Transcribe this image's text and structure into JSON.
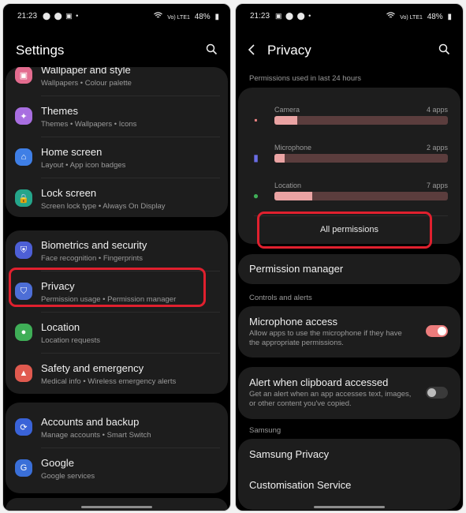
{
  "left": {
    "status": {
      "time": "21:23",
      "icons": "⬤ ⬤ ▣ •",
      "signal": "Vo) LTE1",
      "battery": "48%"
    },
    "title": "Settings",
    "card1": [
      {
        "title": "Wallpaper and style",
        "subtitle": "Wallpapers  •  Colour palette",
        "icon": "wallpaper-icon",
        "color": "#e36c8f"
      },
      {
        "title": "Themes",
        "subtitle": "Themes  •  Wallpapers  •  Icons",
        "icon": "themes-icon",
        "color": "#a86ee0"
      },
      {
        "title": "Home screen",
        "subtitle": "Layout  •  App icon badges",
        "icon": "home-icon",
        "color": "#3f7fe6"
      },
      {
        "title": "Lock screen",
        "subtitle": "Screen lock type  •  Always On Display",
        "icon": "lock-icon",
        "color": "#25a58a"
      }
    ],
    "card2": [
      {
        "title": "Biometrics and security",
        "subtitle": "Face recognition  •  Fingerprints",
        "icon": "shield-icon",
        "color": "#4d5fd6"
      },
      {
        "title": "Privacy",
        "subtitle": "Permission usage  •  Permission manager",
        "icon": "privacy-icon",
        "color": "#4d6ed6"
      },
      {
        "title": "Location",
        "subtitle": "Location requests",
        "icon": "location-pin-icon",
        "color": "#3fae57"
      },
      {
        "title": "Safety and emergency",
        "subtitle": "Medical info  •  Wireless emergency alerts",
        "icon": "emergency-icon",
        "color": "#e05a4f"
      }
    ],
    "card3": [
      {
        "title": "Accounts and backup",
        "subtitle": "Manage accounts  •  Smart Switch",
        "icon": "sync-icon",
        "color": "#3a63d8"
      },
      {
        "title": "Google",
        "subtitle": "Google services",
        "icon": "google-icon",
        "color": "#3a6fd8"
      }
    ]
  },
  "right": {
    "status": {
      "time": "21:23",
      "icons": "▣ ⬤ ⬤ •",
      "signal": "Vo) LTE1",
      "battery": "48%"
    },
    "title": "Privacy",
    "usage_header": "Permissions used in last 24 hours",
    "permissions": [
      {
        "label": "Camera",
        "count": "4 apps",
        "fraction": 0.13,
        "icon": "camera-icon",
        "color": "#ee8383"
      },
      {
        "label": "Microphone",
        "count": "2 apps",
        "fraction": 0.06,
        "icon": "microphone-icon",
        "color": "#6a6de6"
      },
      {
        "label": "Location",
        "count": "7 apps",
        "fraction": 0.22,
        "icon": "location-pin-icon",
        "color": "#3fae57"
      }
    ],
    "all_permissions": "All permissions",
    "permission_manager": "Permission manager",
    "controls_header": "Controls and alerts",
    "mic_access": {
      "title": "Microphone access",
      "desc": "Allow apps to use the microphone if they have the appropriate permissions.",
      "on": true
    },
    "clipboard": {
      "title": "Alert when clipboard accessed",
      "desc": "Get an alert when an app accesses text, images, or other content you've copied.",
      "on": false
    },
    "samsung_header": "Samsung",
    "samsung_privacy": "Samsung Privacy",
    "customisation": "Customisation Service"
  },
  "colors": {
    "highlight": "#e0202e",
    "toggle_on": "#ec7c7c",
    "toggle_off": "#bcbcbc"
  }
}
